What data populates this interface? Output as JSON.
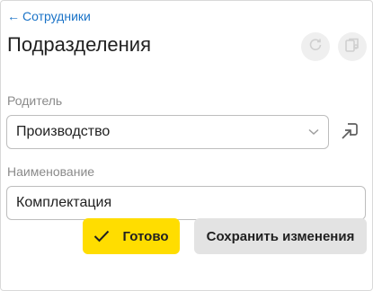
{
  "header": {
    "back_label": "Сотрудники",
    "title": "Подразделения"
  },
  "toolbar": {
    "refresh_icon": "refresh-icon",
    "copy_icon": "copy-settings-icon"
  },
  "form": {
    "parent_label": "Родитель",
    "parent_value": "Производство",
    "parent_dropdown_icon": "chevron-down-icon",
    "parent_open_icon": "open-in-window-icon",
    "name_label": "Наименование",
    "name_value": "Комплектация"
  },
  "actions": {
    "done_label": "Готово",
    "save_label": "Сохранить изменения"
  },
  "colors": {
    "link": "#1a73c7",
    "primary_button": "#ffdd00",
    "secondary_button": "#e3e3e3"
  }
}
